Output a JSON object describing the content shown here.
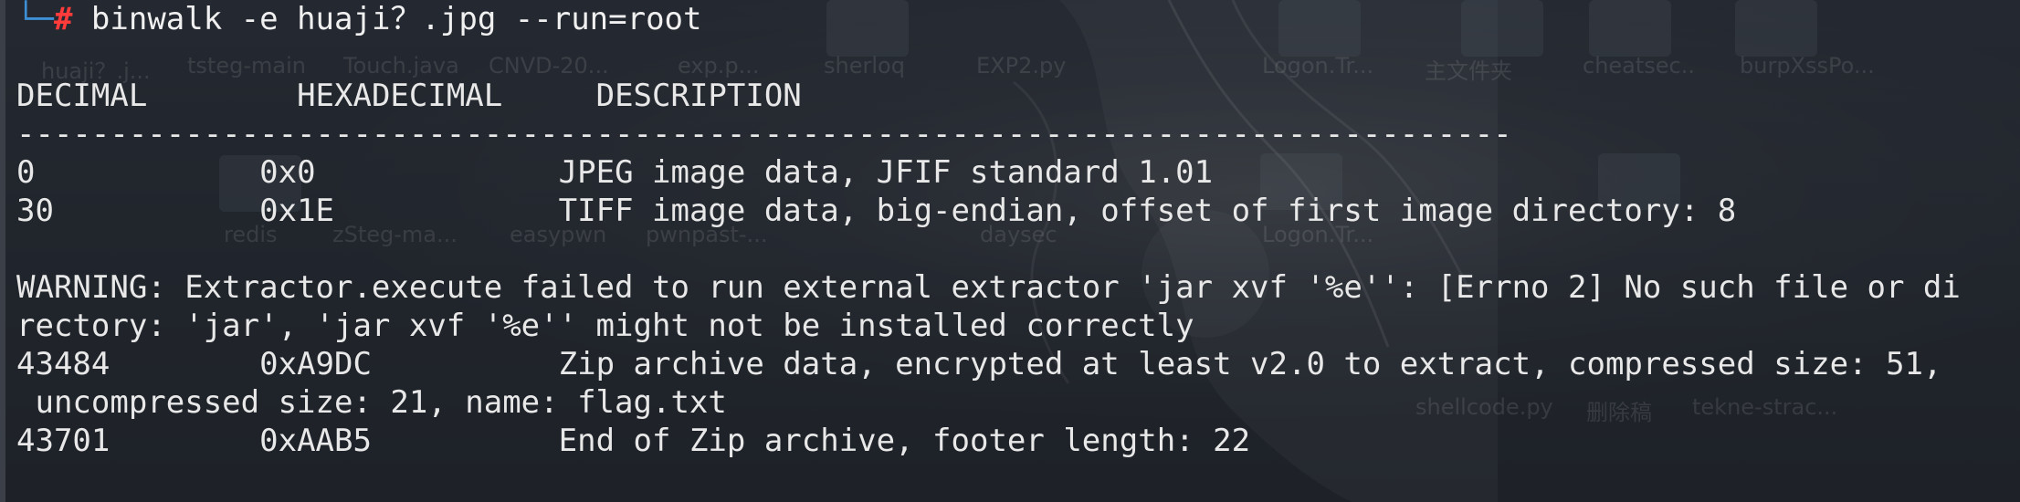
{
  "prompt": {
    "corner": "└─",
    "symbol": "#",
    "command": "binwalk -e huaji？.jpg --run=root"
  },
  "table": {
    "headers": [
      "DECIMAL",
      "HEXADECIMAL",
      "DESCRIPTION"
    ],
    "separator": "--------------------------------------------------------------------------------",
    "rows": [
      {
        "decimal": "0",
        "hex": "0x0",
        "description": "JPEG image data, JFIF standard 1.01"
      },
      {
        "decimal": "30",
        "hex": "0x1E",
        "description": "TIFF image data, big-endian, offset of first image directory: 8"
      }
    ]
  },
  "warning": {
    "line1": "WARNING: Extractor.execute failed to run external extractor 'jar xvf '%e'': [Errno 2] No such file or di",
    "line2": "rectory: 'jar', 'jar xvf '%e'' might not be installed correctly"
  },
  "rows_after": [
    {
      "decimal": "43484",
      "hex": "0xA9DC",
      "description": "Zip archive data, encrypted at least v2.0 to extract, compressed size: 51,",
      "continuation": " uncompressed size: 21, name: flag.txt"
    },
    {
      "decimal": "43701",
      "hex": "0xAAB5",
      "description": "End of Zip archive, footer length: 22"
    }
  ],
  "background_labels": [
    "huaji？.j...",
    "tsteg-main",
    "Touch.java",
    "CNVD-20...",
    "exp.p...",
    "sherloq",
    "EXP2.py",
    "Logon.Tr...",
    "主文件夹",
    "cheatsec..",
    "burpXssPo...",
    "redis",
    "zSteg-ma...",
    "easypwn",
    "pwnpast-...",
    "daysec",
    "Logon.Tr...",
    "shellcode.py",
    "删除稿",
    "tekne-strac..."
  ],
  "colors": {
    "background": "#20242b",
    "prompt_corner": "#3d8fd6",
    "prompt_hash": "#ff3b3b",
    "text": "#e8e8e8"
  }
}
